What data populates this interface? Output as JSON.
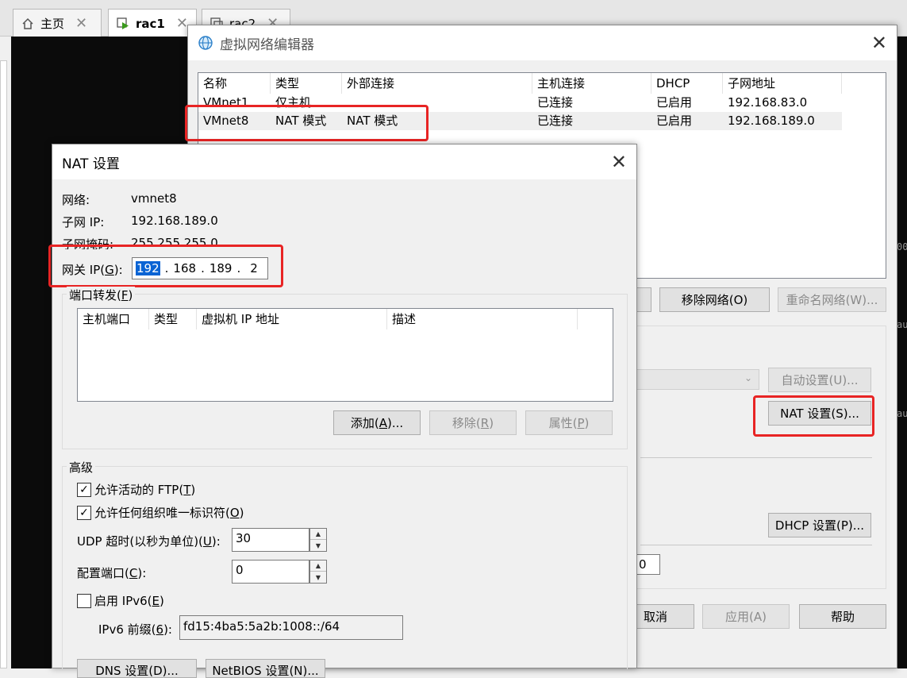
{
  "tabs": [
    {
      "label": "主页",
      "icon": "home-icon"
    },
    {
      "label": "rac1",
      "icon": "vm-running-icon"
    },
    {
      "label": "rac2",
      "icon": "vm-icon"
    }
  ],
  "console": {
    "fragments": [
      "00",
      "au",
      "au"
    ]
  },
  "vne": {
    "title": "虚拟网络编辑器",
    "columns": [
      "名称",
      "类型",
      "外部连接",
      "主机连接",
      "DHCP",
      "子网地址"
    ],
    "rows": [
      {
        "name": "VMnet1",
        "type": "仅主机...",
        "external": "",
        "host": "已连接",
        "dhcp": "已启用",
        "subnet": "192.168.83.0"
      },
      {
        "name": "VMnet8",
        "type": "NAT 模式",
        "external": "NAT 模式",
        "host": "已连接",
        "dhcp": "已启用",
        "subnet": "192.168.189.0"
      }
    ],
    "buttons": {
      "remove_network": "移除网络(O)",
      "rename_network": "重命名网络(W)...",
      "auto_settings": "自动设置(U)...",
      "nat_settings": "NAT 设置(S)...",
      "dhcp_settings": "DHCP 设置(P)...",
      "cancel": "取消",
      "apply": "应用(A)",
      "help": "帮助"
    },
    "field_fragment": "0"
  },
  "nat": {
    "title": "NAT 设置",
    "network_label": "网络:",
    "network_value": "vmnet8",
    "subnet_ip_label": "子网 IP:",
    "subnet_ip_value": "192.168.189.0",
    "subnet_mask_label": "子网掩码:",
    "subnet_mask_value": "255.255.255.0",
    "gateway_label_pre": "网关 IP(",
    "gateway_key": "G",
    "gateway_label_post": "):",
    "gateway": {
      "o1": "192",
      "o2": "168",
      "o3": "189",
      "o4": "2"
    },
    "port_forwarding": {
      "label_pre": "端口转发(",
      "key": "F",
      "label_post": ")",
      "columns": [
        "主机端口",
        "类型",
        "虚拟机 IP 地址",
        "描述"
      ],
      "add": {
        "pre": "添加(",
        "key": "A",
        "post": ")..."
      },
      "remove": {
        "pre": "移除(",
        "key": "R",
        "post": ")"
      },
      "properties": {
        "pre": "属性(",
        "key": "P",
        "post": ")"
      }
    },
    "advanced": {
      "label": "高级",
      "allow_ftp": {
        "pre": "允许活动的 FTP(",
        "key": "T",
        "post": ")",
        "checked": true
      },
      "allow_oui": {
        "pre": "允许任何组织唯一标识符(",
        "key": "O",
        "post": ")",
        "checked": true
      },
      "udp_timeout": {
        "pre": "UDP 超时(以秒为单位)(",
        "key": "U",
        "post": "):",
        "value": "30"
      },
      "config_port": {
        "pre": "配置端口(",
        "key": "C",
        "post": "):",
        "value": "0"
      },
      "enable_ipv6": {
        "pre": "启用 IPv6(",
        "key": "E",
        "post": ")",
        "checked": false
      },
      "ipv6_prefix": {
        "pre": "IPv6 前缀(",
        "key": "6",
        "post": "):",
        "value": "fd15:4ba5:5a2b:1008::/64"
      }
    },
    "dns_settings": "DNS 设置(D)...",
    "netbios_settings": "NetBIOS 设置(N)..."
  },
  "colors": {
    "highlight_red": "#e82424",
    "selection_blue": "#0a64d4"
  }
}
